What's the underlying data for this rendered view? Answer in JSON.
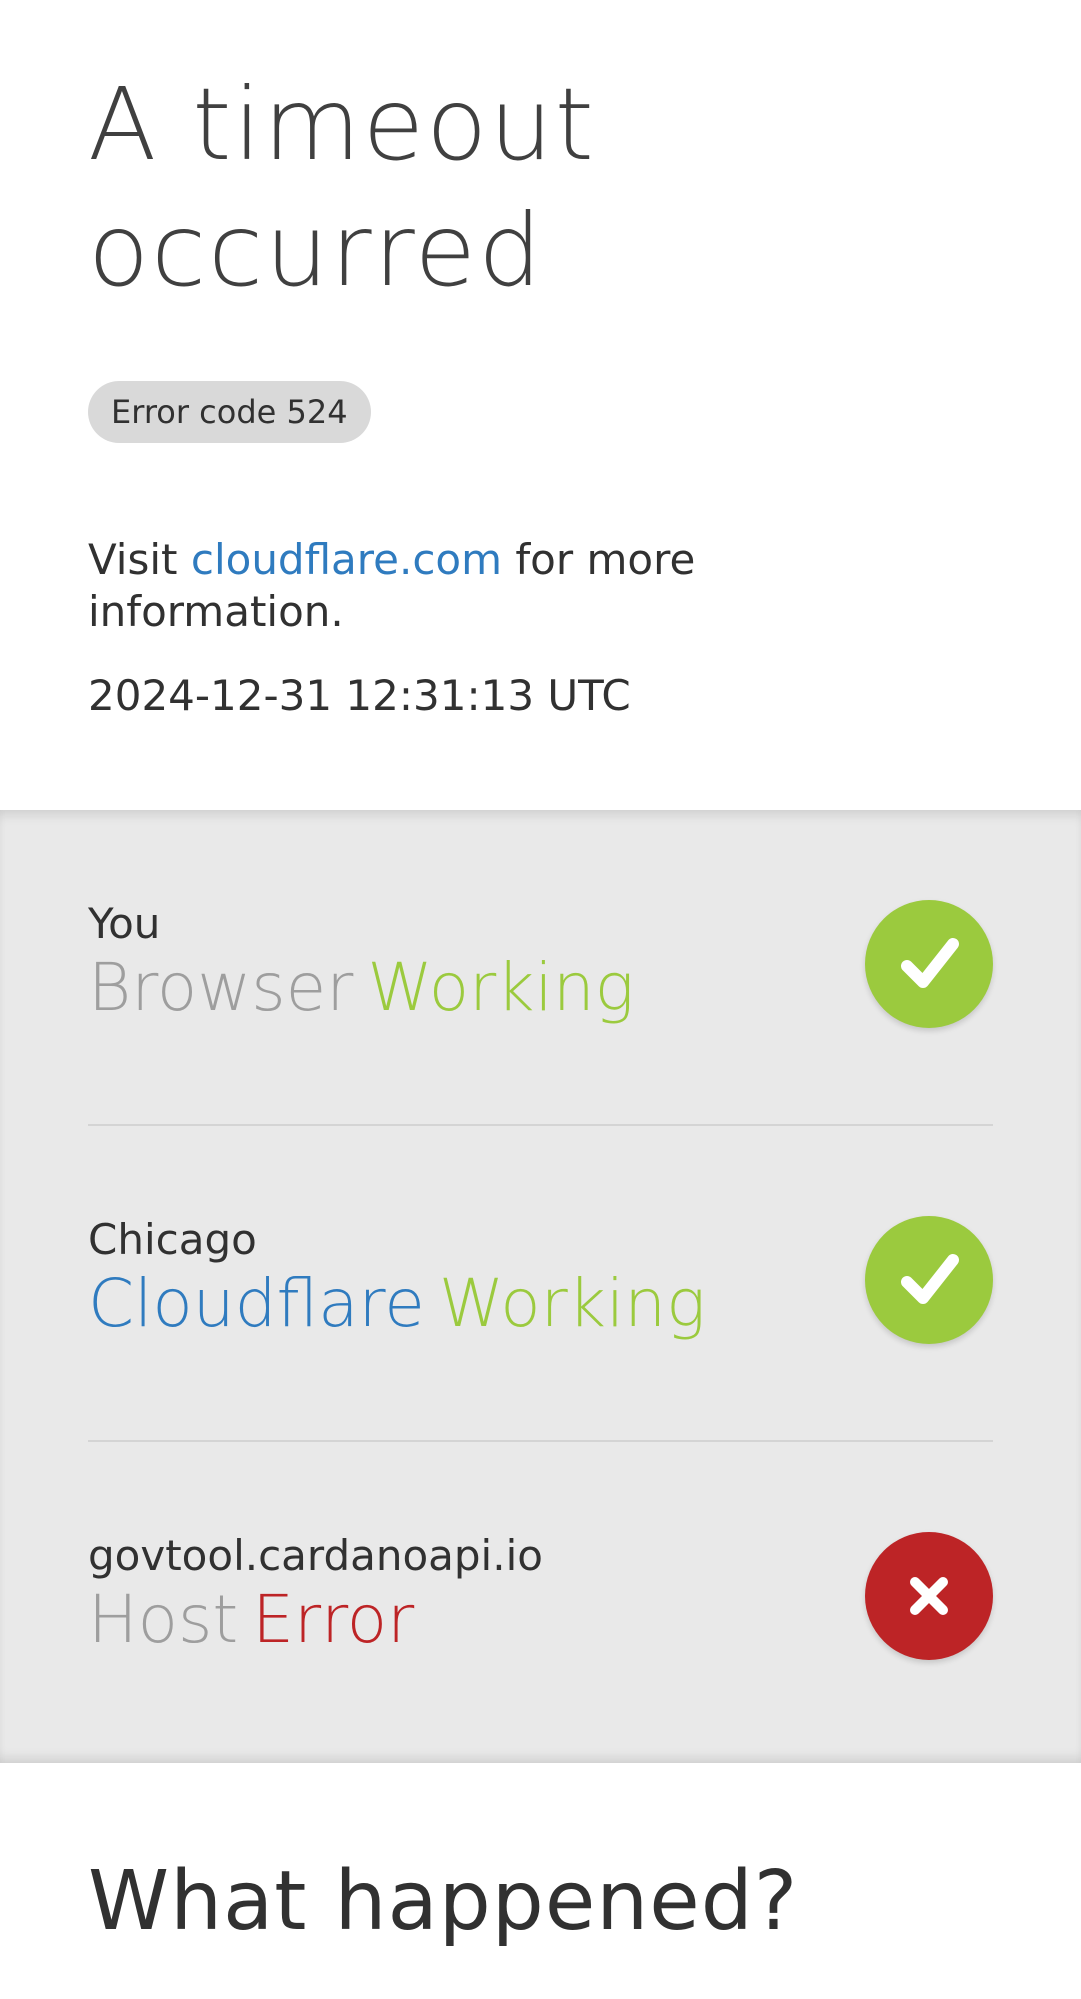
{
  "header": {
    "title": "A timeout occurred",
    "error_badge": "Error code 524",
    "visit_prefix": "Visit",
    "visit_link": "cloudflare.com",
    "visit_suffix": "for more information.",
    "timestamp": "2024-12-31 12:31:13 UTC"
  },
  "status": {
    "rows": [
      {
        "location": "You",
        "service": "Browser",
        "state": "Working",
        "icon": "checkmark-icon"
      },
      {
        "location": "Chicago",
        "service": "Cloudflare",
        "state": "Working",
        "icon": "checkmark-icon"
      },
      {
        "location": "govtool.cardanoapi.io",
        "service": "Host",
        "state": "Error",
        "icon": "cross-icon"
      }
    ]
  },
  "footer": {
    "heading": "What happened?"
  },
  "colors": {
    "ok": "#9bca3e",
    "error": "#bd2426",
    "link": "#2f7bbf",
    "band": "#e9e9e9"
  }
}
